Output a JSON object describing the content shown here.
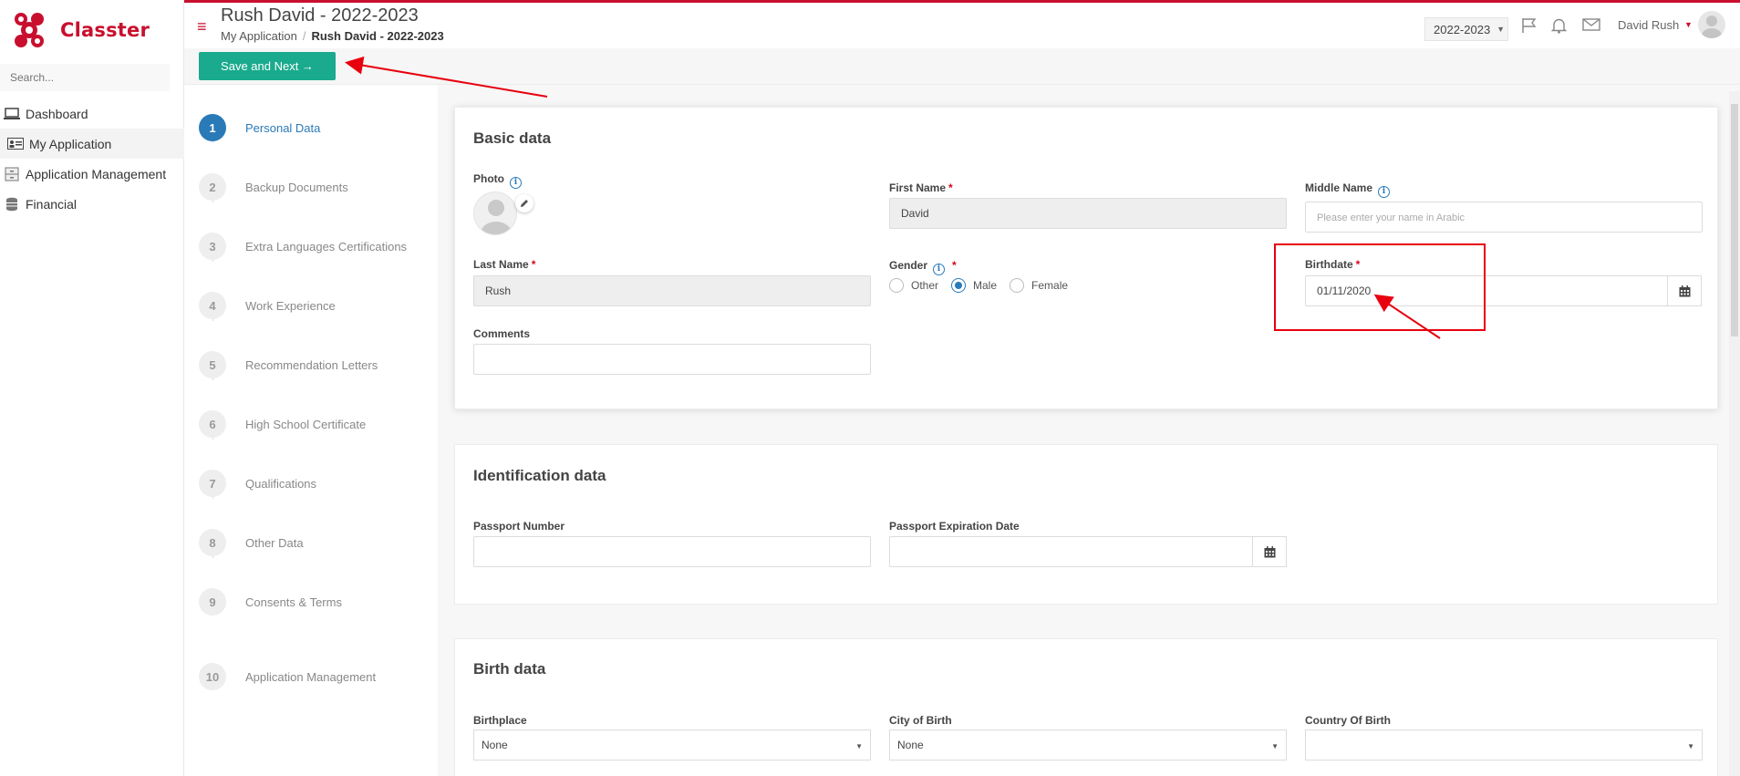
{
  "app": {
    "brand": "Classter",
    "brand_color": "#c8102e",
    "accent": "#2a7ab8",
    "button_color": "#1aaa8d"
  },
  "sidebar": {
    "search_placeholder": "Search...",
    "items": [
      {
        "label": "Dashboard",
        "icon": "laptop-icon",
        "active": false
      },
      {
        "label": "My Application",
        "icon": "id-card-icon",
        "active": true
      },
      {
        "label": "Application Management",
        "icon": "cabinet-icon",
        "active": false
      },
      {
        "label": "Financial",
        "icon": "coins-icon",
        "active": false
      }
    ]
  },
  "header": {
    "title": "Rush David - 2022-2023",
    "breadcrumb": {
      "parent": "My Application",
      "separator": "/",
      "current": "Rush David - 2022-2023"
    },
    "year": "2022-2023",
    "user_name": "David Rush"
  },
  "toolbar": {
    "save_label": "Save and Next →"
  },
  "steps": [
    {
      "num": "1",
      "label": "Personal Data",
      "active": true
    },
    {
      "num": "2",
      "label": "Backup Documents",
      "active": false
    },
    {
      "num": "3",
      "label": "Extra Languages Certifications",
      "active": false
    },
    {
      "num": "4",
      "label": "Work Experience",
      "active": false
    },
    {
      "num": "5",
      "label": "Recommendation Letters",
      "active": false
    },
    {
      "num": "6",
      "label": "High School Certificate",
      "active": false
    },
    {
      "num": "7",
      "label": "Qualifications",
      "active": false
    },
    {
      "num": "8",
      "label": "Other Data",
      "active": false
    },
    {
      "num": "9",
      "label": "Consents & Terms",
      "active": false
    },
    {
      "num": "10",
      "label": "Application Management",
      "active": false
    }
  ],
  "basic": {
    "title": "Basic data",
    "photo_label": "Photo",
    "first_name": {
      "label": "First Name",
      "required": "*",
      "value": "David"
    },
    "middle_name": {
      "label": "Middle Name",
      "placeholder": "Please enter your name in Arabic"
    },
    "last_name": {
      "label": "Last Name",
      "required": "*",
      "value": "Rush"
    },
    "gender": {
      "label": "Gender",
      "required": "*",
      "options": [
        "Other",
        "Male",
        "Female"
      ],
      "selected": "Male"
    },
    "birthdate": {
      "label": "Birthdate",
      "required": "*",
      "value": "01/11/2020"
    },
    "comments": {
      "label": "Comments",
      "value": ""
    }
  },
  "identification": {
    "title": "Identification data",
    "passport_number": {
      "label": "Passport Number",
      "value": ""
    },
    "passport_expiration": {
      "label": "Passport Expiration Date",
      "value": ""
    }
  },
  "birth": {
    "title": "Birth data",
    "birthplace": {
      "label": "Birthplace",
      "value": "None"
    },
    "city": {
      "label": "City of Birth",
      "value": "None"
    },
    "country": {
      "label": "Country Of Birth",
      "value": ""
    }
  }
}
